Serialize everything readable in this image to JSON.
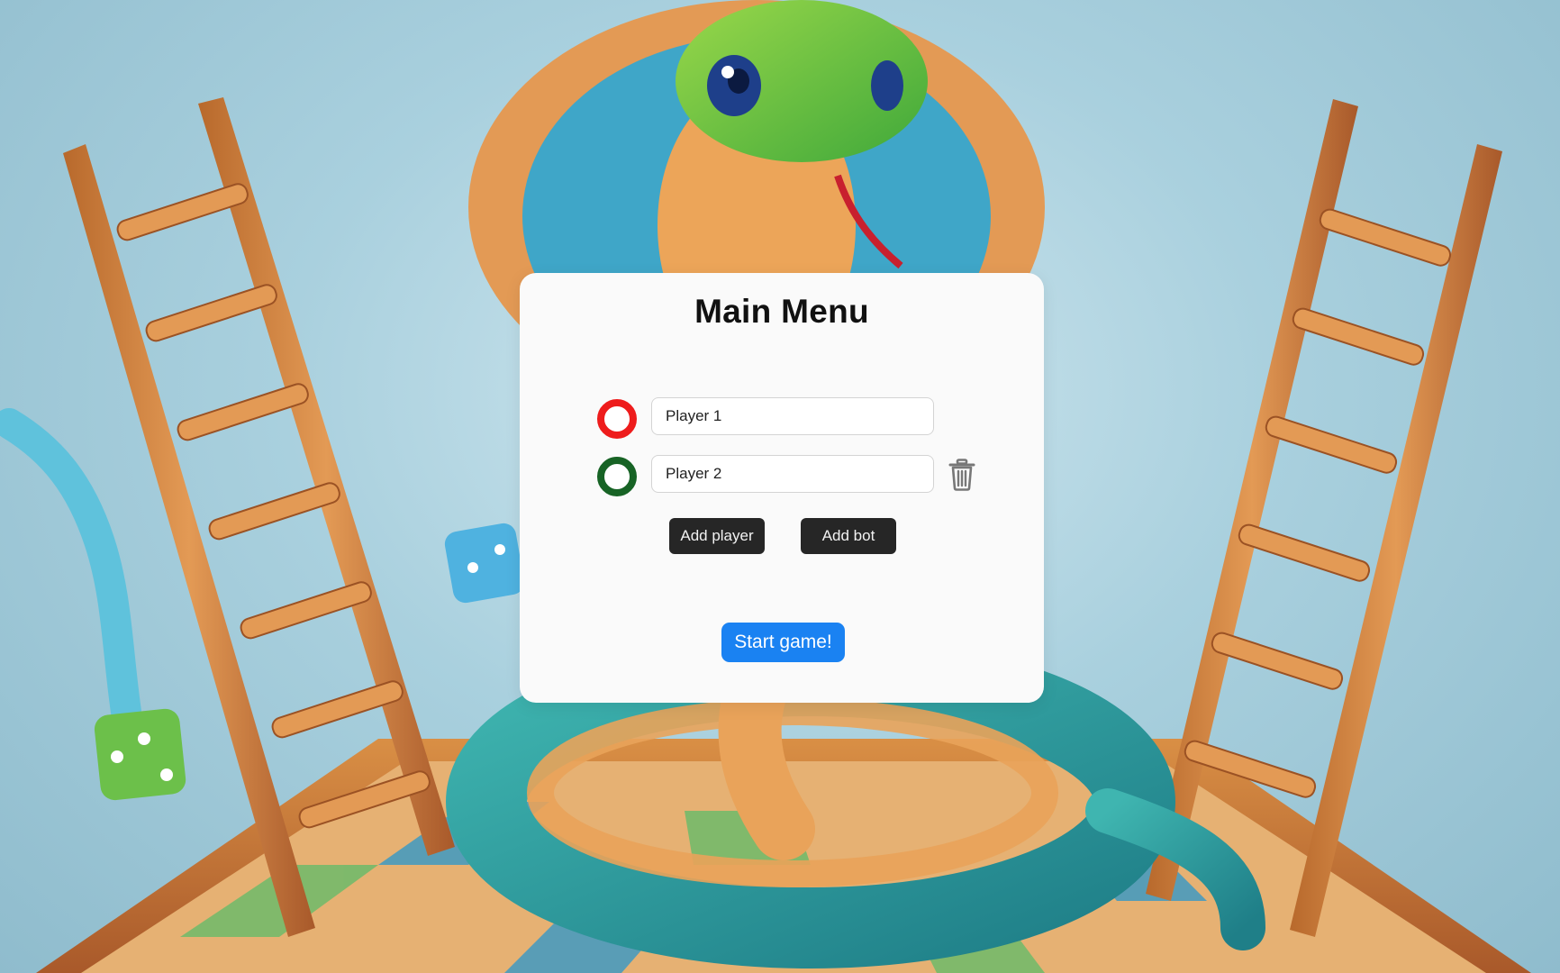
{
  "menu": {
    "title": "Main Menu",
    "players": [
      {
        "name": "Player 1",
        "token_color": "#ee1c1c",
        "removable": false
      },
      {
        "name": "Player 2",
        "token_color": "#176325",
        "removable": true
      }
    ],
    "add_player_label": "Add player",
    "add_bot_label": "Add bot",
    "start_label": "Start game!"
  },
  "icons": {
    "remove_player": "trash-icon"
  },
  "colors": {
    "start_button": "#1a82f2",
    "secondary_button": "#262626",
    "card_background": "#fafafa"
  }
}
